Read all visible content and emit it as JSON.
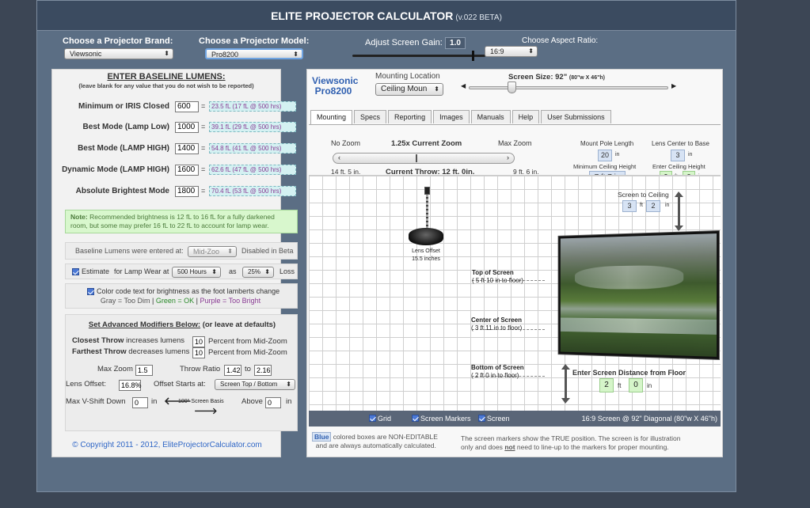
{
  "header": {
    "title": "ELITE PROJECTOR CALCULATOR",
    "version": "(v.022 BETA)"
  },
  "top": {
    "brand_label": "Choose a Projector Brand:",
    "brand_value": "Viewsonic",
    "model_label": "Choose a Projector Model:",
    "model_value": "Pro8200",
    "gain_label": "Adjust Screen Gain:",
    "gain_value": "1.0",
    "gain_slider_fraction": 0.9,
    "aspect_label": "Choose Aspect Ratio:",
    "aspect_value": "16:9"
  },
  "left": {
    "title": "ENTER BASELINE LUMENS:",
    "subtitle": "(leave blank for any value that you do not wish to be reported)",
    "rows": [
      {
        "label": "Minimum or IRIS Closed",
        "value": "600",
        "eq": "=",
        "result": "23.5 fL (17 fL @ 500 hrs)"
      },
      {
        "label": "Best Mode (Lamp Low)",
        "value": "1000",
        "eq": "=",
        "result": "39.1 fL (29 fL @ 500 hrs)"
      },
      {
        "label": "Best Mode (LAMP HIGH)",
        "value": "1400",
        "eq": "=",
        "result": "54.8 fL (41 fL @ 500 hrs)"
      },
      {
        "label": "Dynamic Mode (LAMP HIGH)",
        "value": "1600",
        "eq": "=",
        "result": "62.6 fL (47 fL @ 500 hrs)"
      },
      {
        "label": "Absolute Brightest Mode",
        "value": "1800",
        "eq": "=",
        "result": "70.4 fL (53 fL @ 500 hrs)"
      }
    ],
    "note_bold": "Note:",
    "note_text": "Recommended brightness is 12 fL to 16 fL for a fully darkened room, but some may prefer 16 fL to 22 fL to account for lamp wear.",
    "baseline_label": "Baseline Lumens were entered at:",
    "baseline_value": "Mid-Zoo",
    "baseline_suffix": "Disabled in Beta",
    "estimate_label": "Estimate",
    "estimate_mid": "for Lamp Wear at",
    "hours_value": "500 Hours",
    "as_label": "as",
    "pct_value": "25%",
    "loss_label": "Loss",
    "color_code_line1": "Color code text for brightness as the foot lamberts change",
    "gray": "Gray = Too Dim",
    "sep": "|",
    "green": "Green = OK",
    "purple": "Purple = Too Bright",
    "adv_title": "Set Advanced Modifiers Below:",
    "adv_suffix": "(or leave at defaults)",
    "closest_bold": "Closest Throw",
    "closest_text": "increases lumens",
    "closest_val": "10",
    "closest_suffix": "Percent from Mid-Zoom",
    "farthest_bold": "Farthest Throw",
    "farthest_text": "decreases lumens",
    "farthest_val": "10",
    "farthest_suffix": "Percent from Mid-Zoom",
    "maxzoom_label": "Max Zoom",
    "maxzoom_val": "1.5",
    "throw_ratio_label": "Throw Ratio",
    "tr_min": "1.42",
    "to_label": "to",
    "tr_max": "2.16",
    "lens_offset_label": "Lens Offset:",
    "lens_offset_val": "16.8%",
    "offset_starts_label": "Offset Starts at:",
    "offset_starts_val": "Screen Top / Bottom",
    "vshift_label": "Max V-Shift Down",
    "vshift_val": "0",
    "in_label": "in",
    "basis_label": "100° Screen Basis",
    "above_label": "Above",
    "above_val": "0",
    "copyright": "© Copyright 2011 - 2012, EliteProjectorCalculator.com"
  },
  "right": {
    "brand": "Viewsonic",
    "model": "Pro8200",
    "mounting_location_label": "Mounting Location",
    "mounting_value": "Ceiling Moun",
    "screen_size_label": "Screen Size: 92\"",
    "screen_size_detail": "(80\"w X 46\"h)",
    "screen_slider_fraction": 0.2,
    "tabs": [
      "Mounting",
      "Specs",
      "Reporting",
      "Images",
      "Manuals",
      "Help",
      "User Submissions"
    ],
    "no_zoom": "No Zoom",
    "current_zoom": "1.25x Current Zoom",
    "max_zoom": "Max Zoom",
    "zoom_min_throw": "14 ft. 5 in.",
    "current_throw": "Current Throw: 12 ft. 0in.",
    "zoom_max_throw": "9 ft. 6 in.",
    "zoom_slider_fraction": 0.45,
    "mount_pole_label": "Mount Pole Length",
    "mount_pole_val": "20",
    "in": "in",
    "ft": "ft",
    "lens_center_label": "Lens Center to Base",
    "lens_center_val": "3",
    "min_ceiling_label": "Minimum Ceiling Height",
    "min_ceiling_val": "7 ft 7 in",
    "enter_ceiling_label": "Enter Ceiling Height",
    "ceiling_ft": "9",
    "ceiling_in": "0",
    "screen_to_ceiling_label": "Screen to Ceiling",
    "stc_ft": "3",
    "stc_in": "2",
    "lens_offset_label": "Lens Offset",
    "lens_offset_val": "15.5",
    "inches": "inches",
    "top_screen": "Top of Screen",
    "top_screen_val": "( 5 ft 10 in to floor)",
    "center_screen": "Center of Screen",
    "center_screen_val": "( 3 ft 11 in to floor)",
    "bottom_screen": "Bottom of Screen",
    "bottom_screen_val": "( 2 ft 0 in to floor)",
    "floor_label": "Enter Screen Distance from Floor",
    "floor_ft": "2",
    "floor_in": "0",
    "bar_grid": "Grid",
    "bar_markers": "Screen Markers",
    "bar_screen": "Screen",
    "bar_info": "16:9 Screen @ 92\" Diagonal (80\"w X 46\"h)",
    "blue_word": "Blue",
    "blue_text1": "colored boxes are NON-EDITABLE",
    "blue_text2": "and are always automatically calculated.",
    "marker_note1": "The screen markers show the TRUE position. The screen is for illustration",
    "marker_note2a": "only and does",
    "marker_note_not": "not",
    "marker_note2b": "need to line-up to the markers for proper mounting."
  },
  "icons": [
    "arrow-left-icon",
    "arrow-right-icon",
    "projector-icon",
    "height-arrow-icon",
    "checkbox-icon"
  ],
  "colors": {
    "background": "#3c4655",
    "panel": "#5b6e84",
    "header": "#3b4b60",
    "link": "#2f66c6",
    "green_box": "#d5f5c9",
    "blue_box": "#d7e3f4",
    "lumens_text": "#8a3b94"
  }
}
